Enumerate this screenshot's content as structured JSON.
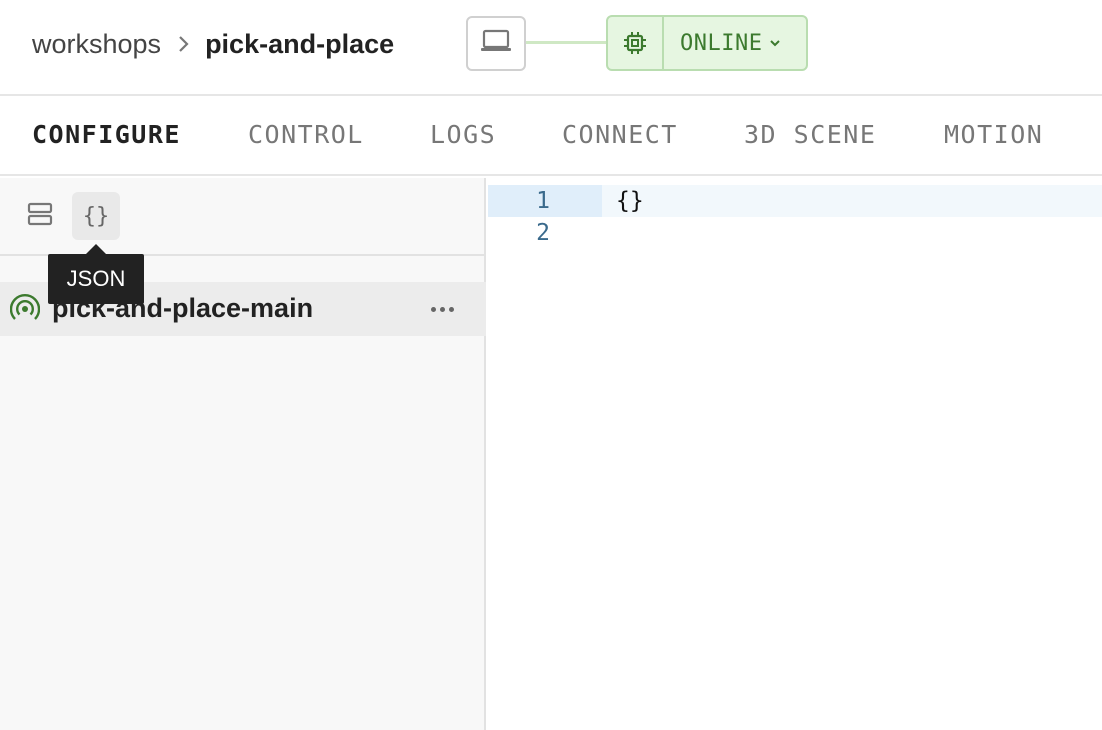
{
  "breadcrumb": {
    "parent": "workshops",
    "current": "pick-and-place"
  },
  "status": {
    "label": "ONLINE",
    "color": "#3c7a2e"
  },
  "tabs": [
    {
      "label": "CONFIGURE",
      "active": true
    },
    {
      "label": "CONTROL",
      "active": false
    },
    {
      "label": "LOGS",
      "active": false
    },
    {
      "label": "CONNECT",
      "active": false
    },
    {
      "label": "3D SCENE",
      "active": false
    },
    {
      "label": "MOTION",
      "active": false
    }
  ],
  "toolbar": {
    "builder_icon": "list-view-icon",
    "json_button_label": "{}",
    "tooltip": "JSON"
  },
  "tree": {
    "items": [
      {
        "label": "pick-and-place-main",
        "icon": "signal-icon"
      }
    ]
  },
  "editor": {
    "lines": [
      {
        "number": "1",
        "text": "{}"
      },
      {
        "number": "2",
        "text": ""
      }
    ]
  },
  "colors": {
    "accent_green": "#3c7a2e",
    "status_bg": "#e6f6e1",
    "line_number": "#3a6a8c"
  }
}
